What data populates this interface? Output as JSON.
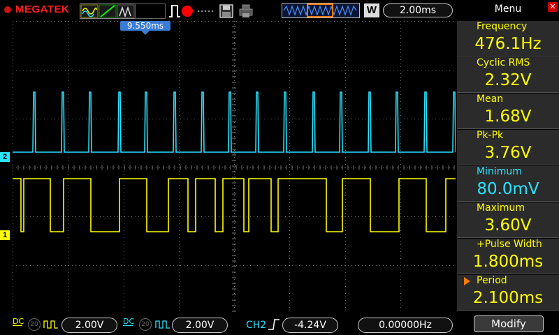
{
  "header": {
    "brand": "MEGATEK",
    "timebase": "2.00ms",
    "trigger_mode_letter": "W",
    "menu_title": "Menu"
  },
  "waveform": {
    "time_marker": "9.550ms",
    "ch1_marker": "1",
    "ch2_marker": "2"
  },
  "measurements": [
    {
      "label": "Frequency",
      "value": "476.1Hz",
      "color": "#ffff00"
    },
    {
      "label": "Cyclic RMS",
      "value": "2.32V",
      "color": "#ffff00"
    },
    {
      "label": "Mean",
      "value": "1.68V",
      "color": "#ffff00"
    },
    {
      "label": "Pk-Pk",
      "value": "3.76V",
      "color": "#ffff00"
    },
    {
      "label": "Minimum",
      "value": "80.0mV",
      "color": "#29e3ff"
    },
    {
      "label": "Maximum",
      "value": "3.60V",
      "color": "#ffff00"
    },
    {
      "label": "+Pulse Width",
      "value": "1.800ms",
      "color": "#ffff00"
    },
    {
      "label": "Period",
      "value": "2.100ms",
      "color": "#ffff00"
    }
  ],
  "footer": {
    "ch1_volts": "2.00V",
    "ch2_volts": "2.00V",
    "trig_source": "CH2",
    "trig_level": "-4.24V",
    "trig_freq": "0.00000Hz",
    "coupling": "DC",
    "bw_limit": "20",
    "modify_label": "Modify"
  },
  "colors": {
    "ch1": "#ffff00",
    "ch2": "#29e3ff",
    "brand": "#ff1e1e",
    "marker": "#3a7bd5"
  }
}
